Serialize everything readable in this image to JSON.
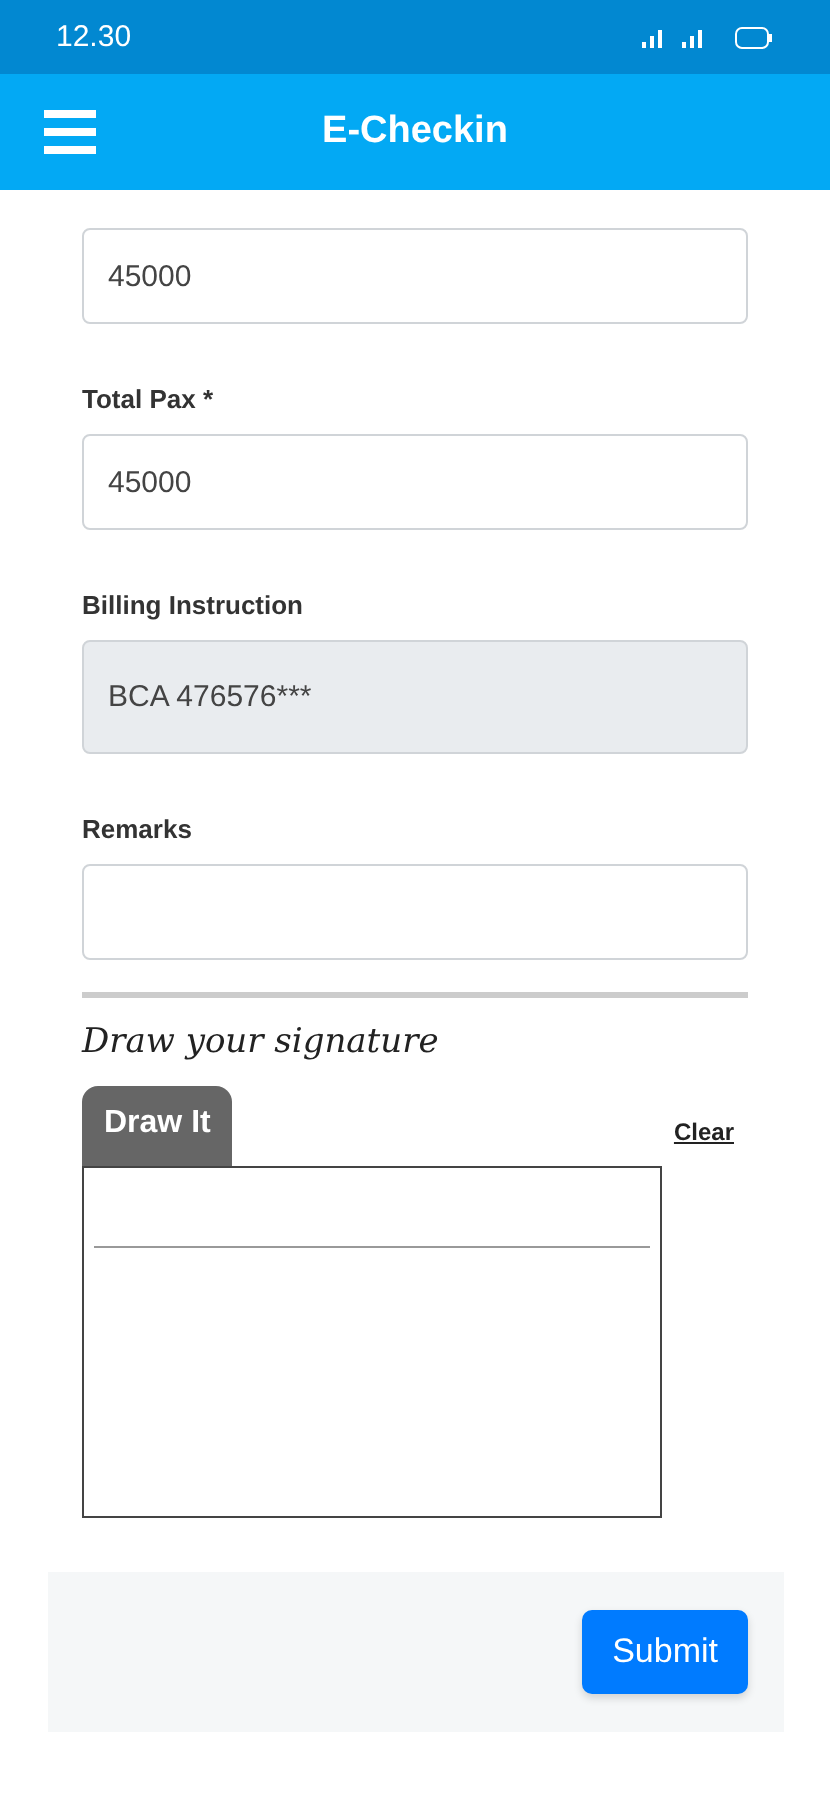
{
  "status_bar": {
    "time": "12.30"
  },
  "app_bar": {
    "title": "E-Checkin"
  },
  "fields": [
    {
      "value": "45000",
      "disabled": false
    },
    {
      "label": "Total Pax *",
      "value": "45000",
      "disabled": false
    },
    {
      "label": "Billing Instruction",
      "value": "BCA 476576***",
      "disabled": true
    },
    {
      "label": "Remarks",
      "disabled": false
    }
  ],
  "signature": {
    "heading": "Draw your signature",
    "tab": "Draw It",
    "clear": "Clear"
  },
  "footer": {
    "submit": "Submit"
  }
}
